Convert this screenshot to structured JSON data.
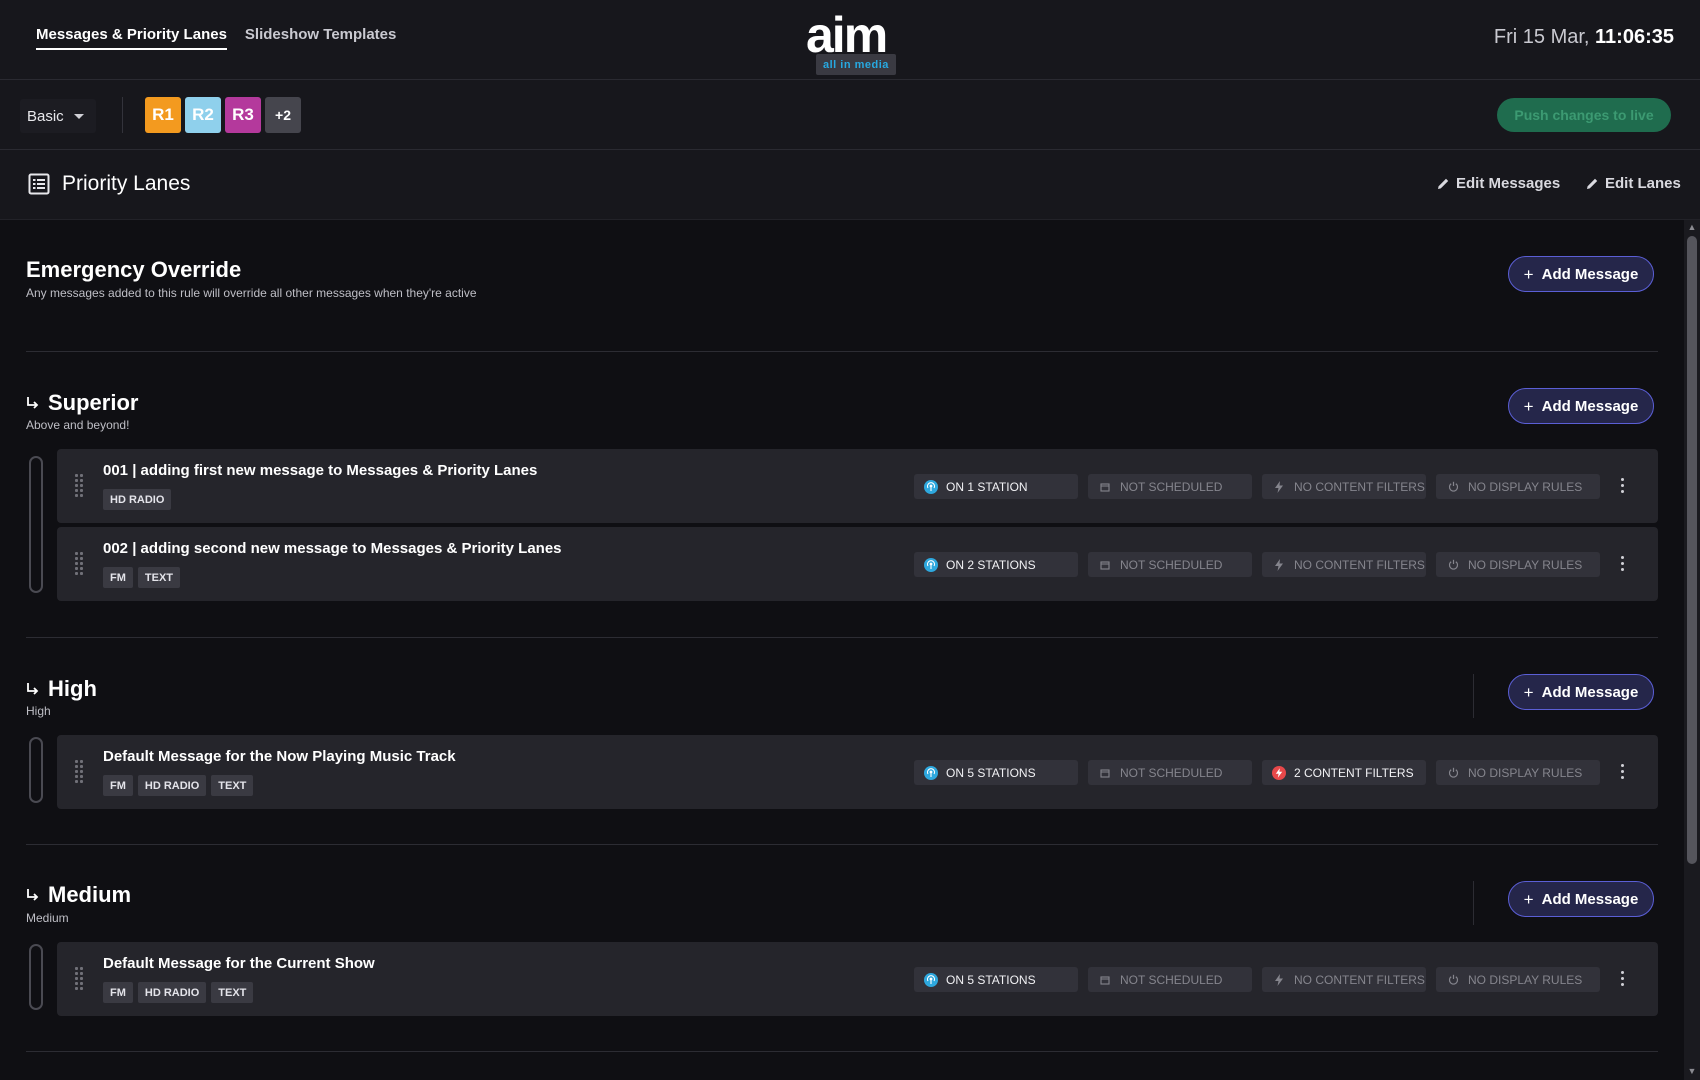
{
  "nav": {
    "tabs": [
      {
        "label": "Messages & Priority Lanes",
        "active": true
      },
      {
        "label": "Slideshow Templates",
        "active": false
      }
    ],
    "logo": {
      "word": "aim",
      "tagline": "all in media"
    },
    "clock": {
      "date": "Fri 15 Mar,",
      "time": "11:06:35"
    }
  },
  "toolbar": {
    "select_value": "Basic",
    "stations": [
      {
        "label": "R1",
        "color": "#f39a1f"
      },
      {
        "label": "R2",
        "color": "#8fd0ec"
      },
      {
        "label": "R3",
        "color": "#b4399c"
      },
      {
        "label": "+2",
        "color": "#45454d"
      }
    ],
    "push_label": "Push changes to live"
  },
  "page": {
    "title": "Priority Lanes",
    "edit_messages": "Edit Messages",
    "edit_lanes": "Edit Lanes"
  },
  "add_message_label": "Add Message",
  "lanes": [
    {
      "title": "Emergency Override",
      "subtitle": "Any messages added to this rule will override all other messages when they're active",
      "messages": []
    },
    {
      "title": "Superior",
      "subtitle": "Above and beyond!",
      "messages": [
        {
          "title": "001 | adding first new message to Messages & Priority Lanes",
          "tags": [
            "HD RADIO"
          ],
          "stations": "ON 1 STATION",
          "schedule": "NOT SCHEDULED",
          "filters": "NO CONTENT FILTERS",
          "rules": "NO DISPLAY RULES"
        },
        {
          "title": "002 | adding second new message to Messages & Priority Lanes",
          "tags": [
            "FM",
            "TEXT"
          ],
          "stations": "ON 2 STATIONS",
          "schedule": "NOT SCHEDULED",
          "filters": "NO CONTENT FILTERS",
          "rules": "NO DISPLAY RULES"
        }
      ]
    },
    {
      "title": "High",
      "subtitle": "High",
      "messages": [
        {
          "title": "Default Message for the Now Playing Music Track",
          "tags": [
            "FM",
            "HD RADIO",
            "TEXT"
          ],
          "stations": "ON 5 STATIONS",
          "schedule": "NOT SCHEDULED",
          "filters": "2 CONTENT FILTERS",
          "rules": "NO DISPLAY RULES"
        }
      ]
    },
    {
      "title": "Medium",
      "subtitle": "Medium",
      "messages": [
        {
          "title": "Default Message for the Current Show",
          "tags": [
            "FM",
            "HD RADIO",
            "TEXT"
          ],
          "stations": "ON 5 STATIONS",
          "schedule": "NOT SCHEDULED",
          "filters": "NO CONTENT FILTERS",
          "rules": "NO DISPLAY RULES"
        }
      ]
    }
  ],
  "colors": {
    "accent": "#5b5fd6",
    "station_icon": "#2ea8de",
    "filter_active": "#e8484a",
    "push_button": "#1f6c4e"
  },
  "icons": {
    "page": "list-icon",
    "edit": "pencil-icon",
    "lane": "subdirectory-arrow-icon",
    "drag": "drag-handle-icon",
    "stations": "broadcast-icon",
    "schedule": "calendar-icon",
    "filters": "bolt-icon",
    "rules": "power-icon",
    "menu": "kebab-menu-icon"
  }
}
